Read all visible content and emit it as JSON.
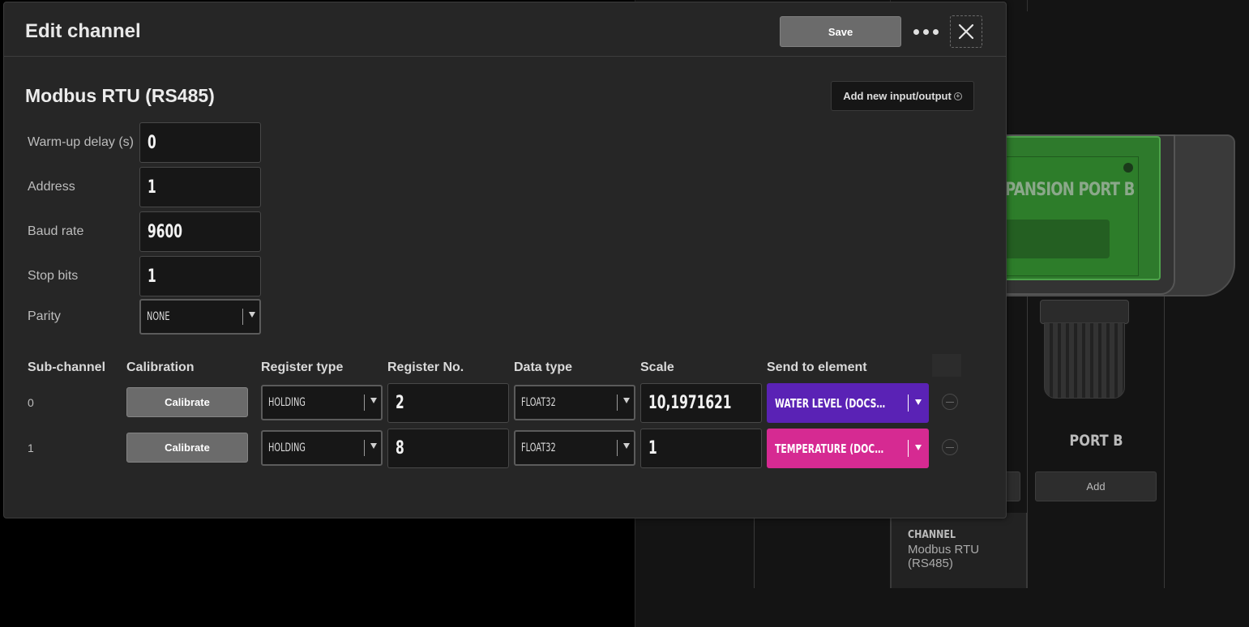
{
  "background": {
    "device_label": "PANSION PORT B",
    "port_label": "PORT B",
    "add_button": "Add",
    "channel_card": {
      "label": "CHANNEL",
      "value": "Modbus RTU (RS485)"
    }
  },
  "modal": {
    "title": "Edit channel",
    "save_label": "Save",
    "section_title": "Modbus RTU (RS485)",
    "add_io_label": "Add new input/output",
    "fields": {
      "warmup": {
        "label": "Warm-up delay (s)",
        "value": "0"
      },
      "address": {
        "label": "Address",
        "value": "1"
      },
      "baud": {
        "label": "Baud rate",
        "value": "9600"
      },
      "stopbits": {
        "label": "Stop bits",
        "value": "1"
      },
      "parity": {
        "label": "Parity",
        "value": "NONE"
      }
    },
    "table": {
      "headers": [
        "Sub-channel",
        "Calibration",
        "Register type",
        "Register No.",
        "Data type",
        "Scale",
        "Send to element"
      ],
      "rows": [
        {
          "subchannel": "0",
          "calibrate": "Calibrate",
          "register_type": "HOLDING",
          "register_no": "2",
          "data_type": "FLOAT32",
          "scale": "10,1971621",
          "element": "WATER LEVEL (DOCS LOG...",
          "element_color": "#5a22b5"
        },
        {
          "subchannel": "1",
          "calibrate": "Calibrate",
          "register_type": "HOLDING",
          "register_no": "8",
          "data_type": "FLOAT32",
          "scale": "1",
          "element": "TEMPERATURE (DOCS LOG...",
          "element_color": "#d62a92"
        }
      ]
    }
  },
  "icons": {
    "more": "more-dots-icon",
    "close": "close-icon",
    "add": "plus-circle-icon",
    "remove": "minus-circle-icon",
    "dropdown": "chevron-down-icon"
  }
}
